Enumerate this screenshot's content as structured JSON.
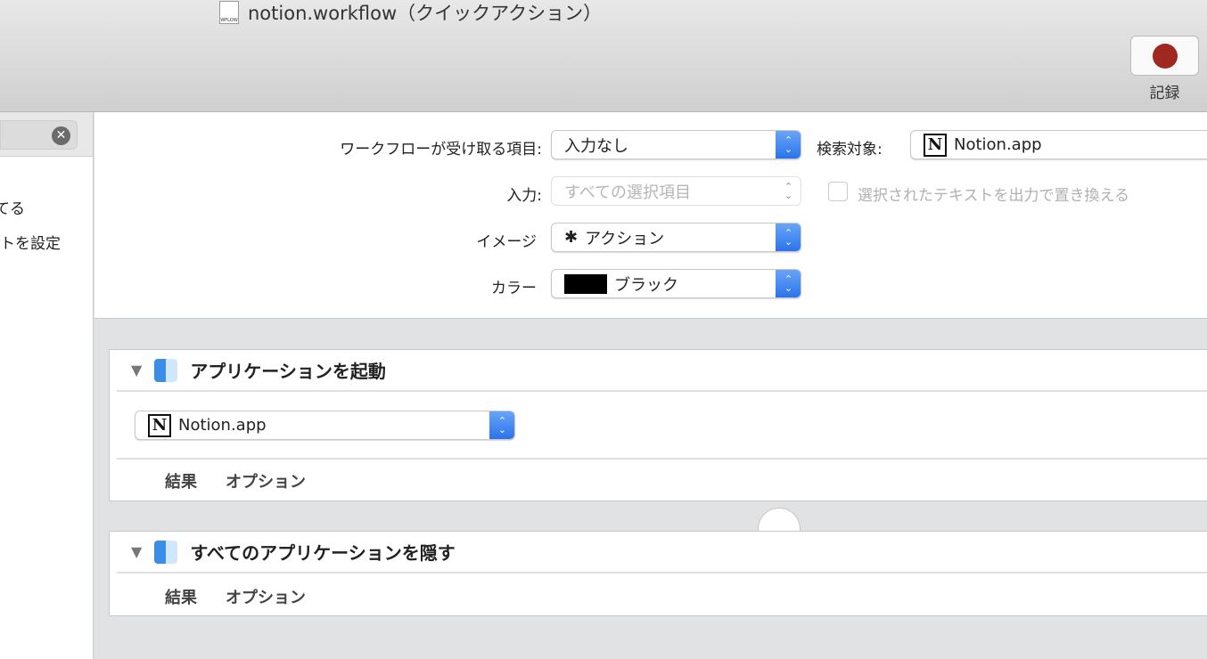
{
  "window": {
    "title": "notion.workflow（クイックアクション）",
    "doc_icon_label": "WFLOW",
    "record_label": "記録"
  },
  "sidebar": {
    "items": [
      "てる",
      "トを設定"
    ]
  },
  "config": {
    "receives_label": "ワークフローが受け取る項目:",
    "receives_value": "入力なし",
    "search_label": "検索対象:",
    "search_value": "Notion.app",
    "input_label": "入力:",
    "input_value": "すべての選択項目",
    "replace_label": "選択されたテキストを出力で置き換える",
    "image_label": "イメージ",
    "image_value": "アクション",
    "color_label": "カラー",
    "color_value": "ブラック",
    "color_swatch": "#000000"
  },
  "actions": [
    {
      "title": "アプリケーションを起動",
      "app": "Notion.app",
      "tabs": [
        "結果",
        "オプション"
      ]
    },
    {
      "title": "すべてのアプリケーションを隠す",
      "tabs": [
        "結果",
        "オプション"
      ]
    }
  ]
}
